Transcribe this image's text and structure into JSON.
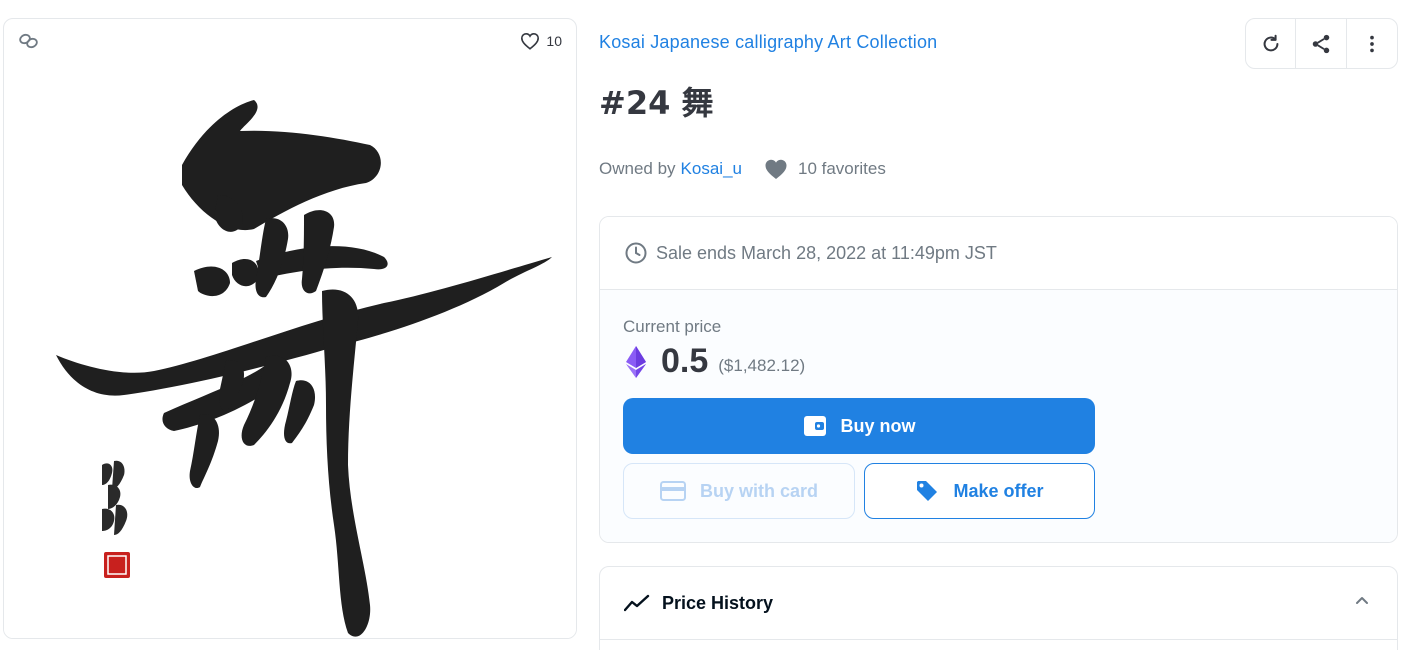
{
  "art": {
    "favorite_count": "10",
    "image_alt": "舞"
  },
  "collection": {
    "name": "Kosai Japanese calligraphy Art Collection"
  },
  "item": {
    "title": "#24 舞",
    "owned_by_label": "Owned by",
    "owner": "Kosai_u",
    "favorites_text": "10 favorites"
  },
  "actions": {
    "refresh_icon": "refresh-icon",
    "share_icon": "share-icon",
    "more_icon": "more-vertical-icon"
  },
  "sale": {
    "ends_text": "Sale ends March 28, 2022 at 11:49pm JST",
    "current_price_label": "Current price",
    "price": "0.5",
    "price_usd": "($1,482.12)",
    "currency_icon": "ethereum-icon",
    "buy_now_label": "Buy now",
    "buy_with_card_label": "Buy with card",
    "make_offer_label": "Make offer"
  },
  "price_history": {
    "title": "Price History"
  },
  "colors": {
    "accent": "#2081e2",
    "text_primary": "#353840",
    "text_secondary": "#707a83",
    "border": "#e5e8eb"
  }
}
